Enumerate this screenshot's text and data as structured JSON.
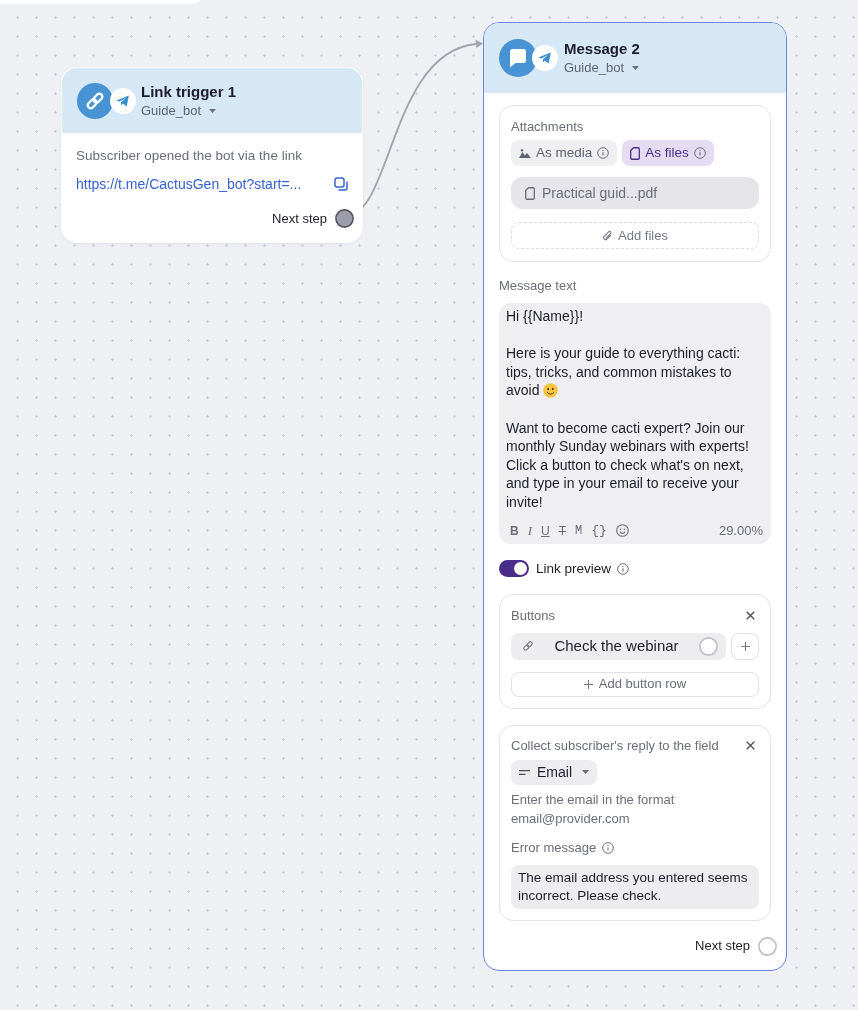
{
  "trigger_node": {
    "selected": false,
    "title": "Link trigger 1",
    "bot": "Guide_bot",
    "description": "Subscriber opened the bot via the link",
    "link": "https://t.me/CactusGen_bot?start=...",
    "next_step": {
      "label": "Next step",
      "connected": true
    }
  },
  "message_node": {
    "selected": true,
    "title": "Message 2",
    "bot": "Guide_bot",
    "attachments": {
      "label": "Attachments",
      "modes": [
        {
          "kind": "media",
          "label": "As media",
          "selected": false
        },
        {
          "kind": "files",
          "label": "As files",
          "selected": true
        }
      ],
      "files": [
        "Practical guid...pdf"
      ],
      "add_label": "Add files"
    },
    "message_text": {
      "label": "Message text",
      "paragraphs": [
        {
          "text": "Hi {{Name}}!",
          "trailing_emoji": false
        },
        {
          "text": "Here is your guide to everything cacti: tips, tricks, and common mistakes to avoid",
          "trailing_emoji": true
        },
        {
          "text": "Want to become cacti expert? Join our monthly Sunday webinars with experts! Click a button to check what's on next, and type in your email to receive your invite!",
          "trailing_emoji": false
        }
      ],
      "toolbar": [
        {
          "kind": "bold",
          "label": "B"
        },
        {
          "kind": "italic",
          "label": "I"
        },
        {
          "kind": "underline",
          "label": "U"
        },
        {
          "kind": "strike",
          "label": "T"
        },
        {
          "kind": "mono",
          "label": "M"
        },
        {
          "kind": "code",
          "label": "{}"
        },
        {
          "kind": "emoji"
        }
      ],
      "counter": "29.00%"
    },
    "link_preview": {
      "label": "Link preview",
      "on": true
    },
    "buttons": {
      "label": "Buttons",
      "rows": [
        [
          {
            "label": "Check the webinar",
            "connected": false
          }
        ]
      ],
      "add_row_label": "Add button row"
    },
    "reply_field": {
      "label": "Collect subscriber's reply to the field",
      "field": "Email",
      "hint": "Enter the email in the format email@provider.com",
      "error_label": "Error message",
      "error_message": "The email address you entered seems incorrect. Please check."
    },
    "next_step": {
      "label": "Next step",
      "connected": false
    }
  }
}
